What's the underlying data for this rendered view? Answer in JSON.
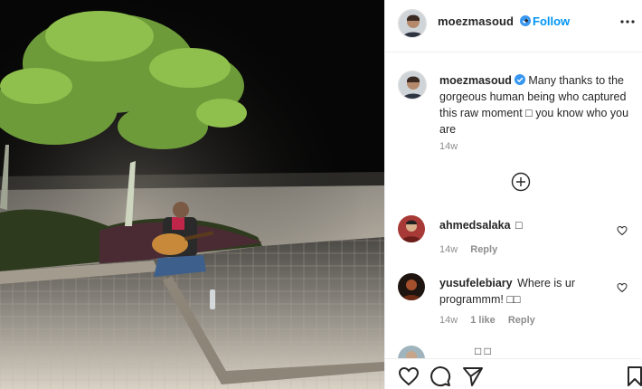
{
  "post": {
    "username": "moezmasoud",
    "separator": "•",
    "follow_label": "Follow",
    "caption": "Many thanks to the gorgeous human being who captured this raw moment □ you know who you are",
    "caption_time": "14w"
  },
  "comments": [
    {
      "username": "ahmedsalaka",
      "text": "□",
      "time": "14w",
      "likes": "",
      "reply_label": "Reply"
    },
    {
      "username": "yusufelebiary",
      "text": "Where is ur programmm! □□",
      "time": "14w",
      "likes": "1 like",
      "reply_label": "Reply"
    }
  ],
  "partial_comment_text": "□ □",
  "icons": {
    "verified": "verified-badge-icon",
    "more": "more-options-icon",
    "load_more": "load-more-comments-icon",
    "like": "heart-icon",
    "comment": "comment-icon",
    "share": "share-icon",
    "save": "save-icon"
  },
  "colors": {
    "link": "#0095f6",
    "verified": "#3897f0",
    "muted": "#8e8e8e",
    "text": "#262626"
  }
}
